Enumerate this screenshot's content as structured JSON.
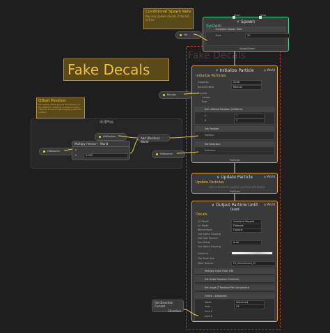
{
  "notes": {
    "spawn_rate": {
      "title": "Conditional Spawn Rate",
      "body": "We only spawn decals if the bit is true"
    },
    "fake_decals": {
      "title": "Fake Decals"
    },
    "offset": {
      "title": "Offset Position",
      "body": "We slightly offset the particle Position in the billboard direction so there is a tiny offset so it doesn't get z-fighting with the surface"
    }
  },
  "system": {
    "label": "System",
    "watermark": "Fake Decals"
  },
  "spawn": {
    "title": "Spawn",
    "start": "Start",
    "stop": "Stop",
    "block": "Constant Spawn Rate",
    "rate_label": "Rate",
    "rate_value": "30",
    "event": "SpawnEvent",
    "input_chip": "Hit"
  },
  "init": {
    "title": "Initialize Particle",
    "subtitle": "Initialize Particles",
    "space": "World",
    "rows": [
      {
        "label": "Capacity",
        "value": "2048"
      },
      {
        "label": "Bounds Mode",
        "value": "Manual"
      }
    ],
    "bounds_label": "Bounds",
    "bounds_rows": [
      "Center",
      "Size"
    ],
    "bounds_chip": "Bounds",
    "lifetime_block": "Set Lifetime Random (Uniform)",
    "lifetime_rows": [
      {
        "label": "A",
        "value": "1"
      },
      {
        "label": "B",
        "value": "3"
      }
    ],
    "position_block": "Set Position",
    "position_row": "Position",
    "direction_block": "Set Direction",
    "direction_row": "Direction",
    "event_out": "Particles"
  },
  "initpos": {
    "group_title": "InitPos",
    "hit_position": "HitPosition",
    "hit_normal": "HitNormal",
    "hit_normal2": "HitNormal",
    "multiply_title": "Multiply (Vector) - World",
    "multiply_a": "a",
    "multiply_b": "b",
    "multiply_b_value": "0.005",
    "add_title": "Add (Position) - World"
  },
  "update": {
    "title": "Update Particle",
    "subtitle": "Update Particles",
    "space": "World",
    "body": "Add a block to update particle attributes",
    "event_out": "Particles"
  },
  "output": {
    "title": "Output Particle Unlit",
    "title2": "Quad",
    "subtitle": "Decals",
    "space": "World",
    "rows": [
      {
        "label": "UV Mode",
        "value": "Gradient Mapped"
      },
      {
        "label": "Uv Mode",
        "value": "Flipbook"
      },
      {
        "label": "Blend Mode",
        "value": "Opaque"
      },
      {
        "label": "Use Alpha Clipping",
        "value": "Alpha"
      },
      {
        "label": "Use Soft Particle",
        "value": ""
      },
      {
        "label": "Sort Mode",
        "value": "Auto"
      },
      {
        "label": "Use Alpha Clipping",
        "value": ""
      }
    ],
    "gradient_label": "Gradient",
    "flipbook_label": "Flip Book Size",
    "main_texture_label": "Main Texture",
    "main_texture_value": "FX_Scorchmark_M",
    "blocks": [
      "Multiply Color Over Life",
      "Set Scale Random (Uniform)",
      "Set Angle.Z Random Per-Component",
      "Orient : Advanced"
    ],
    "orient_rows": [
      {
        "label": "Mode",
        "value": "Advanced"
      },
      {
        "label": "Axes",
        "value": "ZX"
      }
    ],
    "axis_rows": [
      "Axis Z",
      "Axis X"
    ],
    "chip_get": "Get Direction  Current",
    "chip_dir": "Direction"
  },
  "colors": {
    "accent_orange": "#e0a23a",
    "accent_green": "#3fd58a",
    "note_yellow": "#f0c040",
    "flow_red": "#c0392b"
  }
}
